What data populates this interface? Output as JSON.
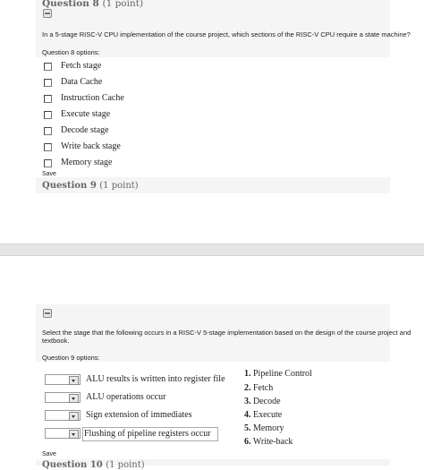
{
  "q8": {
    "heading": "Question 8",
    "points": "(1 point)",
    "prompt": "In a 5-stage RISC-V CPU implementation of the course project, which sections of the RISC-V CPU require a state machine?",
    "options_label": "Question 8 options:",
    "options": [
      "Fetch stage",
      "Data Cache",
      "Instruction Cache",
      "Execute stage",
      "Decode stage",
      "Write back stage",
      "Memory stage"
    ],
    "save_label": "Save"
  },
  "q9": {
    "heading": "Question 9",
    "points": "(1 point)",
    "prompt_line1": "Select the stage that the following occurs in a RISC-V 5-stage implementation based on the design of the course project and",
    "prompt_line2": "textbook.",
    "options_label": "Question 9 options:",
    "items": [
      {
        "text": "ALU results is written into register file",
        "selected": ""
      },
      {
        "text": "ALU operations occur",
        "selected": ""
      },
      {
        "text": "Sign extension of immediates",
        "selected": ""
      },
      {
        "text": "Flushing of pipeline registers occur",
        "selected": ""
      }
    ],
    "choices": [
      {
        "num": "1.",
        "label": "Pipeline Control"
      },
      {
        "num": "2.",
        "label": "Fetch"
      },
      {
        "num": "3.",
        "label": "Decode"
      },
      {
        "num": "4.",
        "label": "Execute"
      },
      {
        "num": "5.",
        "label": "Memory"
      },
      {
        "num": "6.",
        "label": "Write-back"
      }
    ],
    "save_label": "Save"
  },
  "q10": {
    "heading": "Question 10",
    "points": "(1 point)"
  }
}
